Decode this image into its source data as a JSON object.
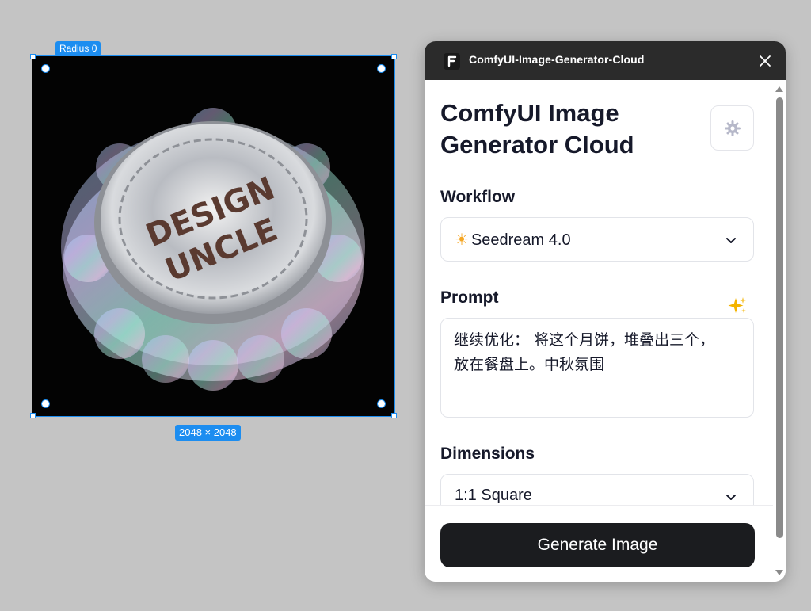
{
  "canvas": {
    "radius_label": "Radius 0",
    "size_label": "2048 × 2048",
    "image": {
      "badge_line1": "DESIGN",
      "badge_line2": "UNCLE"
    }
  },
  "panel": {
    "window_title": "ComfyUI-Image-Generator-Cloud",
    "page_title_line1": "ComfyUI Image",
    "page_title_line2": "Generator Cloud",
    "workflow": {
      "label": "Workflow",
      "selected": "Seedream 4.0",
      "icon": "sun-emoji"
    },
    "prompt": {
      "label": "Prompt",
      "value_line1": "继续优化： 将这个月饼，堆叠出三个，",
      "value_line2": "放在餐盘上。中秋氛围"
    },
    "dimensions": {
      "label": "Dimensions",
      "selected": "1:1 Square"
    },
    "generate_label": "Generate Image"
  },
  "colors": {
    "selection_blue": "#1c8df0",
    "canvas_bg": "#c4c4c4",
    "titlebar_bg": "#2b2b2b",
    "button_bg": "#1b1c1f",
    "text_dark": "#16192a"
  }
}
